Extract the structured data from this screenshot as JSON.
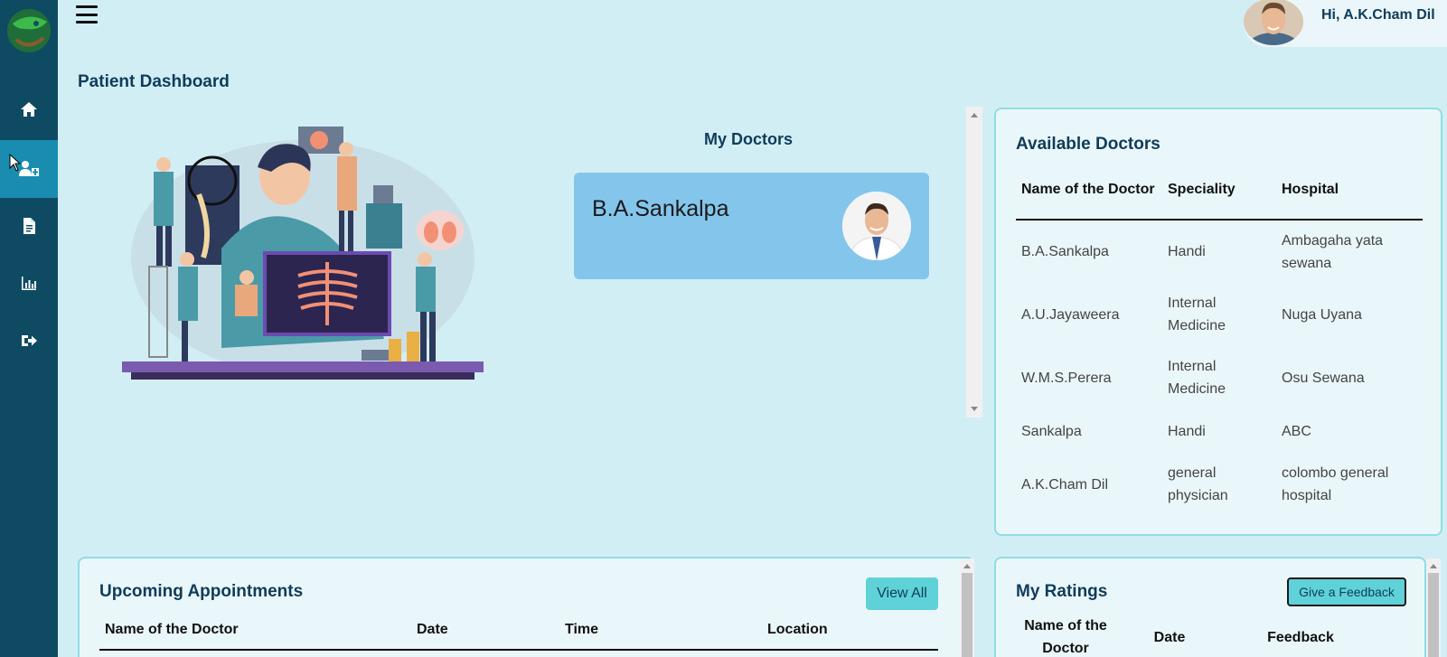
{
  "header": {
    "greeting": "Hi, A.K.Cham Dil"
  },
  "page": {
    "title": "Patient Dashboard"
  },
  "sidebar": {
    "items": [
      {
        "icon": "home-icon"
      },
      {
        "icon": "doctors-icon",
        "active": true
      },
      {
        "icon": "document-icon"
      },
      {
        "icon": "chart-icon"
      },
      {
        "icon": "logout-icon"
      }
    ]
  },
  "my_doctors": {
    "title": "My Doctors",
    "cards": [
      {
        "name": "B.A.Sankalpa"
      }
    ]
  },
  "available_doctors": {
    "title": "Available Doctors",
    "columns": [
      "Name of the Doctor",
      "Speciality",
      "Hospital"
    ],
    "rows": [
      [
        "B.A.Sankalpa",
        "Handi",
        "Ambagaha yata sewana"
      ],
      [
        "A.U.Jayaweera",
        "Internal Medicine",
        "Nuga Uyana"
      ],
      [
        "W.M.S.Perera",
        "Internal Medicine",
        "Osu Sewana"
      ],
      [
        "Sankalpa",
        "Handi",
        "ABC"
      ],
      [
        "A.K.Cham Dil",
        "general physician",
        "colombo general hospital"
      ]
    ]
  },
  "upcoming": {
    "title": "Upcoming Appointments",
    "view_all": "View All",
    "columns": [
      "Name of the Doctor",
      "Date",
      "Time",
      "Location"
    ]
  },
  "ratings": {
    "title": "My Ratings",
    "give_feedback": "Give a Feedback",
    "columns": [
      "Name of the Doctor",
      "Date",
      "Feedback"
    ]
  },
  "colors": {
    "sidebar": "#0f4a63",
    "sidebar_active": "#1a8cb0",
    "background": "#d2eef5",
    "accent_button": "#5fd2d8",
    "doctor_card": "#84c5eb",
    "card_border": "#8fdde3"
  }
}
